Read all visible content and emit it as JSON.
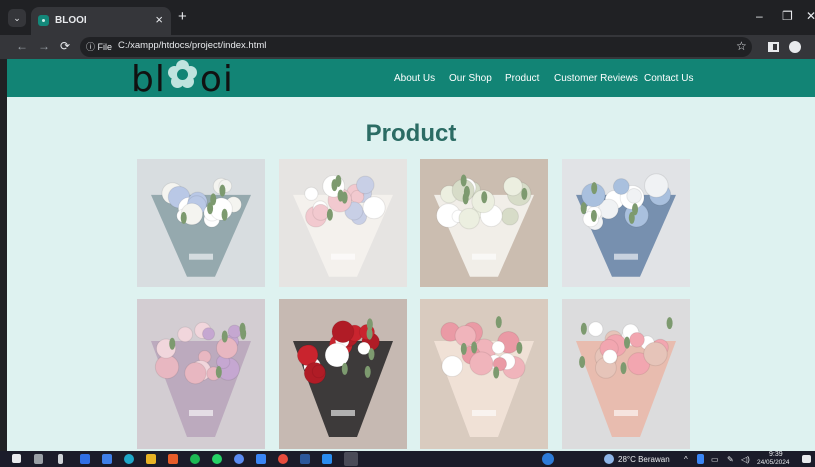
{
  "browser": {
    "tab_title": "BLOOI",
    "tab_close": "×",
    "new_tab": "+",
    "file_chip": "ⓘ File",
    "url": "C:/xampp/htdocs/project/index.html",
    "controls": {
      "minimize": "–",
      "restore": "❐",
      "close": "✕"
    }
  },
  "site": {
    "logo": {
      "part1": "bl",
      "part2": "oi"
    },
    "nav": [
      "About Us",
      "Our Shop",
      "Product",
      "Customer Reviews",
      "Contact Us"
    ],
    "section_title": "Product",
    "products": [
      {
        "bg": "#d8dde0",
        "paper": "#8ea3a8",
        "flowers": [
          "#ffffff",
          "#f4f4f0",
          "#b9c8e6"
        ]
      },
      {
        "bg": "#e6e4e2",
        "paper": "#f5f2ee",
        "flowers": [
          "#f2c9cf",
          "#ffffff",
          "#c8cfe6"
        ]
      },
      {
        "bg": "#cbbdb0",
        "paper": "#f5f3ee",
        "flowers": [
          "#ffffff",
          "#ecefe0",
          "#d7dcc8"
        ]
      },
      {
        "bg": "#e1e3e6",
        "paper": "#6c86a8",
        "flowers": [
          "#ffffff",
          "#a9c0de",
          "#f0f2f4"
        ]
      },
      {
        "bg": "#d3cdd2",
        "paper": "#b9a6bb",
        "flowers": [
          "#e8b7c1",
          "#c5a7d1",
          "#f1d6dc"
        ]
      },
      {
        "bg": "#c6b9b2",
        "paper": "#2e2c2c",
        "flowers": [
          "#c9242e",
          "#b01c26",
          "#ffffff"
        ]
      },
      {
        "bg": "#d9cbbf",
        "paper": "#f2e3d8",
        "flowers": [
          "#f0b4bb",
          "#ea9aa5",
          "#ffffff"
        ]
      },
      {
        "bg": "#dcdcdd",
        "paper": "#e9b8aa",
        "flowers": [
          "#f2a6b0",
          "#ffffff",
          "#e6c4b9"
        ]
      }
    ]
  },
  "taskbar": {
    "weather": "28°C Berawan",
    "time": "9:39",
    "date": "24/05/2024"
  }
}
